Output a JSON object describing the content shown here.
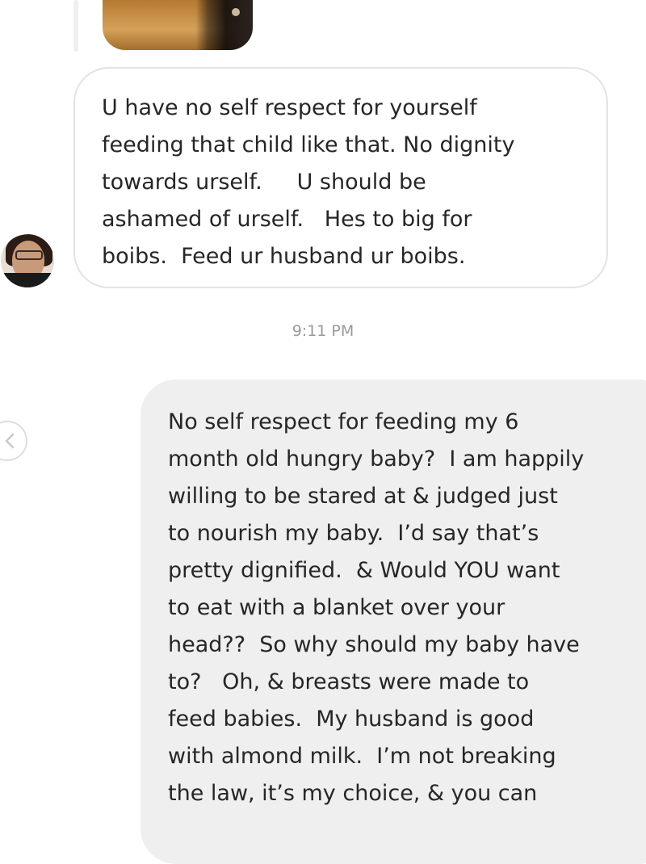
{
  "thread": {
    "incoming_message": {
      "lines": [
        "U have no self respect for yourself",
        "feeding that child like that. No dignity",
        "towards urself.     U should be",
        "ashamed of urself.   Hes to big for",
        "boibs.  Feed ur husband ur boibs."
      ]
    },
    "timestamp": "9:11 PM",
    "outgoing_message": {
      "lines": [
        "No self respect for feeding my 6",
        "month old hungry baby?  I am happily",
        "willing to be stared at & judged just",
        "to nourish my baby.  I’d say that’s",
        "pretty dignified.  & Would YOU want",
        "to eat with a blanket over your",
        "head??  So why should my baby have",
        "to?   Oh, & breasts were made to",
        "feed babies.  My husband is good",
        "with almond milk.  I’m not breaking",
        "the law, it’s my choice, & you can"
      ]
    }
  },
  "icons": {
    "back": "chevron-left-icon",
    "avatar": "sender-avatar"
  },
  "colors": {
    "incoming_bubble_border": "#e3e3e3",
    "outgoing_bubble_bg": "#efefef",
    "text": "#262626",
    "timestamp": "#9a9a9a"
  }
}
